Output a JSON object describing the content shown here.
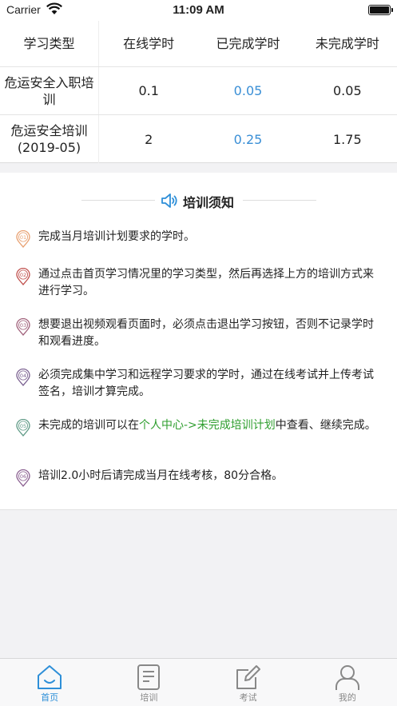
{
  "status_bar": {
    "carrier": "Carrier",
    "time": "11:09 AM"
  },
  "table": {
    "headers": [
      "学习类型",
      "在线学时",
      "已完成学时",
      "未完成学时"
    ],
    "rows": [
      [
        "危运安全入职培训",
        "0.1",
        "0.05",
        "0.05"
      ],
      [
        "危运安全培训\n(2019-05)",
        "2",
        "0.25",
        "1.75"
      ]
    ]
  },
  "notice": {
    "title": "培训须知",
    "items": [
      {
        "num": "01",
        "text": "完成当月培训计划要求的学时。"
      },
      {
        "num": "02",
        "text": "通过点击首页学习情况里的学习类型，然后再选择上方的培训方式来进行学习。"
      },
      {
        "num": "03",
        "text": "想要退出视频观看页面时，必须点击退出学习按钮，否则不记录学时和观看进度。"
      },
      {
        "num": "04",
        "text": "必须完成集中学习和远程学习要求的学时，通过在线考试并上传考试签名，培训才算完成。"
      },
      {
        "num": "05",
        "text_before": "未完成的培训可以在",
        "link": "个人中心->未完成培训计划",
        "text_after": "中查看、继续完成。"
      },
      {
        "num": "06",
        "text": "培训2.0小时后请完成当月在线考核，80分合格。"
      }
    ],
    "pin_colors": [
      "#e8a070",
      "#c0504d",
      "#a0607a",
      "#7a6090",
      "#5f9a86",
      "#8a5f90"
    ]
  },
  "tabbar": {
    "tabs": [
      {
        "label": "首页",
        "icon": "home-icon",
        "active": true
      },
      {
        "label": "培训",
        "icon": "document-icon",
        "active": false
      },
      {
        "label": "考试",
        "icon": "edit-icon",
        "active": false
      },
      {
        "label": "我的",
        "icon": "user-icon",
        "active": false
      }
    ],
    "active_color": "#2e8fd8",
    "inactive_color": "#888888"
  }
}
